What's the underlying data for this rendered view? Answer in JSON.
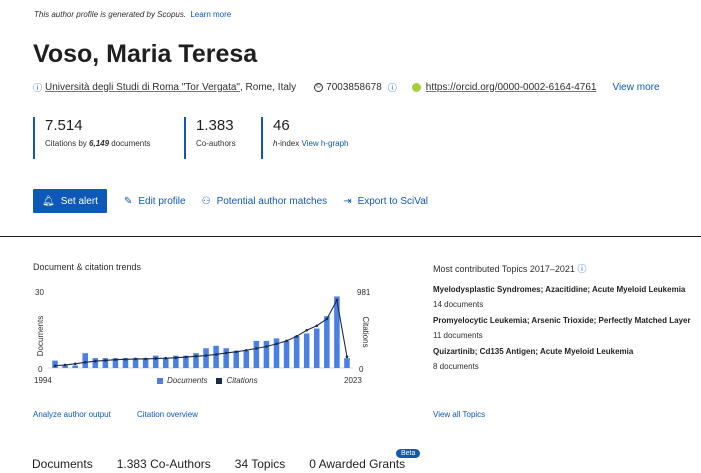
{
  "notice": {
    "text": "This author profile is generated by Scopus.",
    "learn_more": "Learn more"
  },
  "author": {
    "name": "Voso, Maria Teresa",
    "affiliation": "Università degli Studi di Roma \"Tor Vergata\"",
    "location": ", Rome, Italy",
    "scopus_id": "7003858678",
    "orcid": "https://orcid.org/0000-0002-6164-4761",
    "view_more": "View more"
  },
  "metrics": [
    {
      "value": "7.514",
      "label_prefix": "Citations by ",
      "label_bold": "6,149",
      "label_suffix": " documents"
    },
    {
      "value": "1.383",
      "label": "Co-authors"
    },
    {
      "value": "46",
      "label_italic": "h",
      "label_rest": "-index ",
      "label_link": "View h-graph"
    }
  ],
  "actions": {
    "set_alert": "Set alert",
    "edit_profile": "Edit profile",
    "potential_matches": "Potential author matches",
    "export": "Export to SciVal"
  },
  "trends": {
    "title": "Document & citation trends",
    "y_left_max": "30",
    "y_left_min": "0",
    "y_right_max": "981",
    "y_right_min": "0",
    "y_left_label": "Documents",
    "y_right_label": "Citations",
    "x_start": "1994",
    "x_end": "2023",
    "legend_docs": "Documents",
    "legend_cites": "Citations",
    "link_analyze": "Analyze author output",
    "link_overview": "Citation overview"
  },
  "chart_data": {
    "type": "bar",
    "x": [
      1994,
      1995,
      1996,
      1997,
      1998,
      1999,
      2000,
      2001,
      2002,
      2003,
      2004,
      2005,
      2006,
      2007,
      2008,
      2009,
      2010,
      2011,
      2012,
      2013,
      2014,
      2015,
      2016,
      2017,
      2018,
      2019,
      2020,
      2021,
      2022,
      2023
    ],
    "series": [
      {
        "name": "Documents",
        "type": "bar",
        "axis": "left",
        "values": [
          3,
          1,
          1,
          6,
          4,
          4,
          4,
          4,
          4,
          4,
          5,
          4,
          5,
          5,
          6,
          8,
          9,
          8,
          7,
          7,
          11,
          11,
          12,
          11,
          13,
          14,
          16,
          21,
          29,
          4
        ]
      },
      {
        "name": "Citations",
        "type": "line",
        "axis": "right",
        "values": [
          30,
          40,
          55,
          75,
          90,
          100,
          110,
          115,
          120,
          120,
          125,
          130,
          135,
          145,
          155,
          165,
          180,
          200,
          215,
          235,
          260,
          285,
          320,
          360,
          420,
          500,
          560,
          650,
          900,
          150
        ]
      }
    ],
    "ylim_left": [
      0,
      30
    ],
    "ylim_right": [
      0,
      981
    ],
    "colors": {
      "bars": "#4a7fe3",
      "line": "#1c2a4a"
    }
  },
  "topics": {
    "title": "Most contributed Topics 2017–2021",
    "items": [
      {
        "name": "Myelodysplastic Syndromes; Azacitidine; Acute Myeloid Leukemia",
        "docs": "14 documents"
      },
      {
        "name": "Promyelocytic Leukemia; Arsenic Trioxide; Perfectly Matched Layer",
        "docs": "11 documents"
      },
      {
        "name": "Quizartinib; Cd135 Antigen; Acute Myeloid Leukemia",
        "docs": "8 documents"
      }
    ],
    "view_all": "View all Topics"
  },
  "tabs": [
    "Documents",
    "1.383 Co-Authors",
    "34 Topics",
    "0 Awarded Grants"
  ],
  "beta": "Beta"
}
